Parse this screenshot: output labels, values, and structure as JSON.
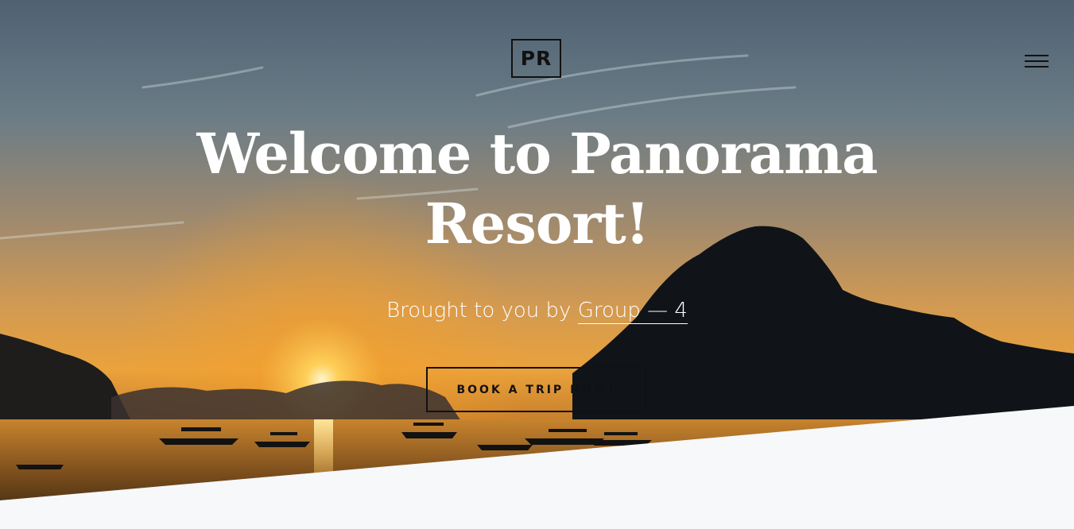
{
  "header": {
    "logo_text": "PR",
    "menu_icon": "hamburger-menu-icon"
  },
  "hero": {
    "title_line1": "Welcome to Panorama",
    "title_line2": "Resort!",
    "subtitle_prefix": "Brought to you by ",
    "subtitle_link": "Group — 4",
    "cta_label": "BOOK A TRIP NOW!",
    "background": "sunset-over-bay-photo"
  },
  "colors": {
    "text_light": "#ffffff",
    "text_dark": "#111111",
    "page_background": "#f7f8fa",
    "sky_top": "#5b6d7c",
    "sunset_orange": "#f4a31f",
    "silhouette": "#0e1418"
  }
}
